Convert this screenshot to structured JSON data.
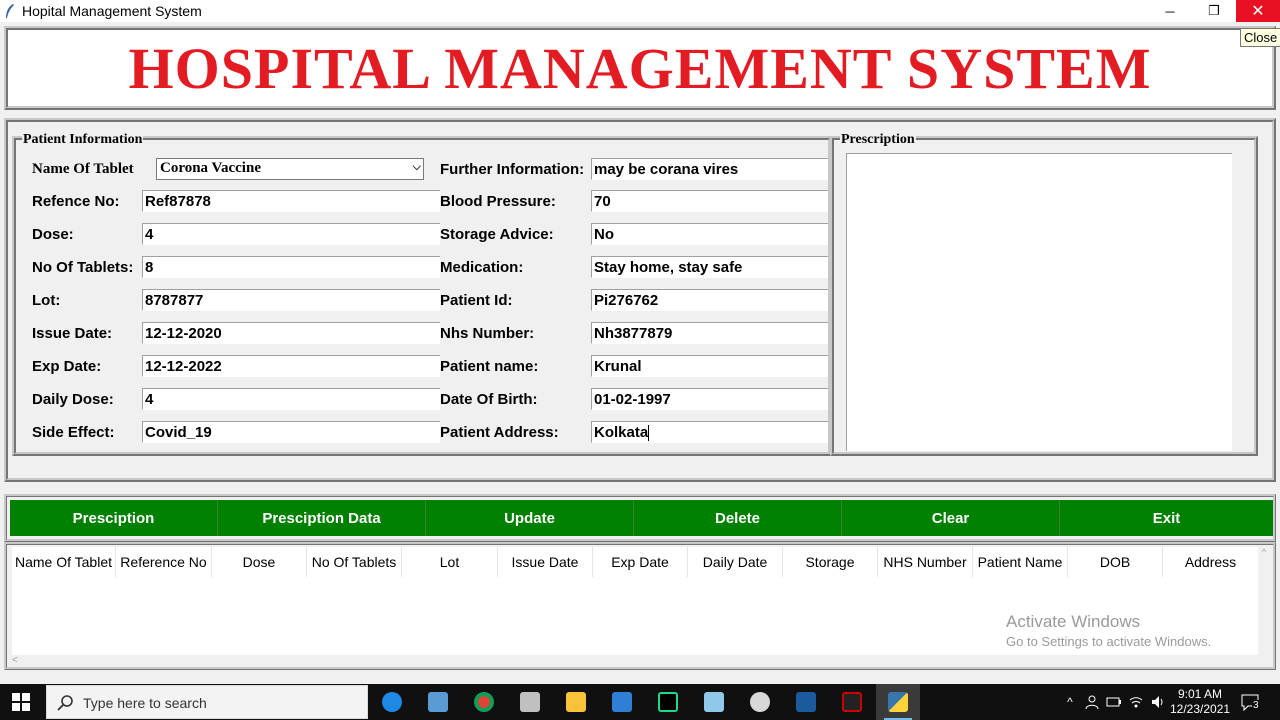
{
  "window": {
    "title": "Hopital Management System",
    "minimize": "─",
    "maximize": "❐",
    "close": "✕",
    "close_tooltip": "Close"
  },
  "header": {
    "title": "HOSPITAL MANAGEMENT SYSTEM",
    "title_color": "#e31b23"
  },
  "patient_info": {
    "title": "Patient Information",
    "tablet_label": "Name Of Tablet",
    "tablet_value": "Corona Vaccine",
    "left_fields": [
      {
        "label": "Refence No:",
        "value": "Ref87878"
      },
      {
        "label": "Dose:",
        "value": "4"
      },
      {
        "label": "No Of Tablets:",
        "value": "8"
      },
      {
        "label": "Lot:",
        "value": "8787877"
      },
      {
        "label": "Issue Date:",
        "value": "12-12-2020"
      },
      {
        "label": "Exp Date:",
        "value": "12-12-2022"
      },
      {
        "label": "Daily Dose:",
        "value": "4"
      },
      {
        "label": "Side Effect:",
        "value": "Covid_19"
      }
    ],
    "right_fields": [
      {
        "label": "Further Information:",
        "value": "may be corana vires"
      },
      {
        "label": "Blood Pressure:",
        "value": "70"
      },
      {
        "label": "Storage Advice:",
        "value": "No"
      },
      {
        "label": "Medication:",
        "value": "Stay home, stay safe"
      },
      {
        "label": "Patient Id:",
        "value": "Pi276762"
      },
      {
        "label": "Nhs Number:",
        "value": "Nh3877879"
      },
      {
        "label": "Patient name:",
        "value": "Krunal"
      },
      {
        "label": "Date Of Birth:",
        "value": "01-02-1997"
      },
      {
        "label": "Patient Address:",
        "value": "Kolkata"
      }
    ]
  },
  "prescription": {
    "title": "Prescription"
  },
  "buttons": [
    "Presciption",
    "Presciption Data",
    "Update",
    "Delete",
    "Clear",
    "Exit"
  ],
  "button_color": "#008000",
  "table": {
    "columns": [
      "Name Of Tablet",
      "Reference No",
      "Dose",
      "No Of Tablets",
      "Lot",
      "Issue Date",
      "Exp Date",
      "Daily Date",
      "Storage",
      "NHS Number",
      "Patient Name",
      "DOB",
      "Address"
    ],
    "scroll_left": "<",
    "scroll_up": "^"
  },
  "watermark": {
    "line1": "Activate Windows",
    "line2": "Go to Settings to activate Windows."
  },
  "taskbar": {
    "search_placeholder": "Type here to search",
    "time": "9:01 AM",
    "date": "12/23/2021",
    "notification_count": "3",
    "tray_up": "^"
  }
}
